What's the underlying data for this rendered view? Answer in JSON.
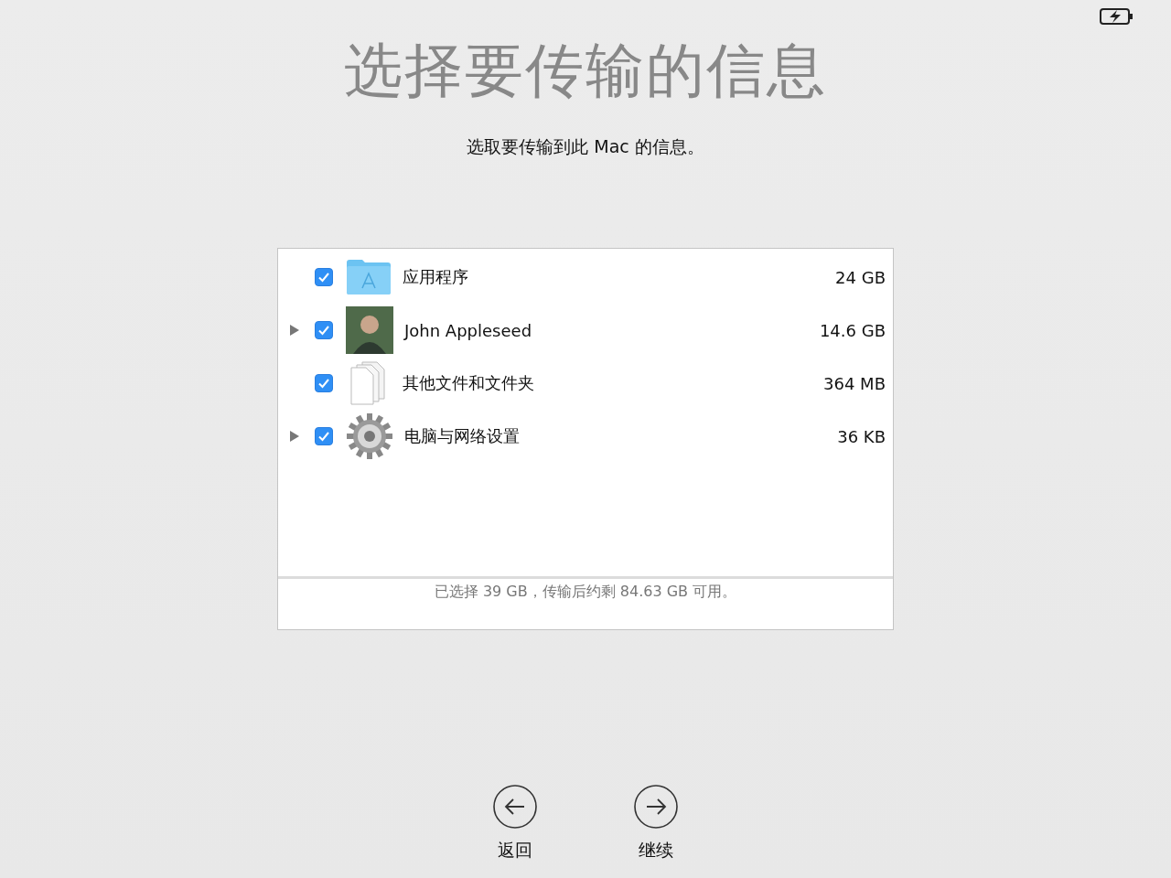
{
  "title": "选择要传输的信息",
  "subtitle": "选取要传输到此 Mac 的信息。",
  "items": [
    {
      "kind": "apps",
      "label": "应用程序",
      "size": "24 GB",
      "checked": true,
      "expandable": false
    },
    {
      "kind": "user",
      "label": "John Appleseed",
      "size": "14.6 GB",
      "checked": true,
      "expandable": true,
      "expanded": false
    },
    {
      "kind": "files",
      "label": "其他文件和文件夹",
      "size": "364 MB",
      "checked": true,
      "expandable": false
    },
    {
      "kind": "settings",
      "label": "电脑与网络设置",
      "size": "36 KB",
      "checked": true,
      "expandable": true,
      "expanded": false
    }
  ],
  "summary": "已选择 39 GB，传输后约剩 84.63 GB 可用。",
  "buttons": [
    {
      "kind": "back",
      "label": "返回"
    },
    {
      "kind": "continue",
      "label": "继续"
    }
  ]
}
